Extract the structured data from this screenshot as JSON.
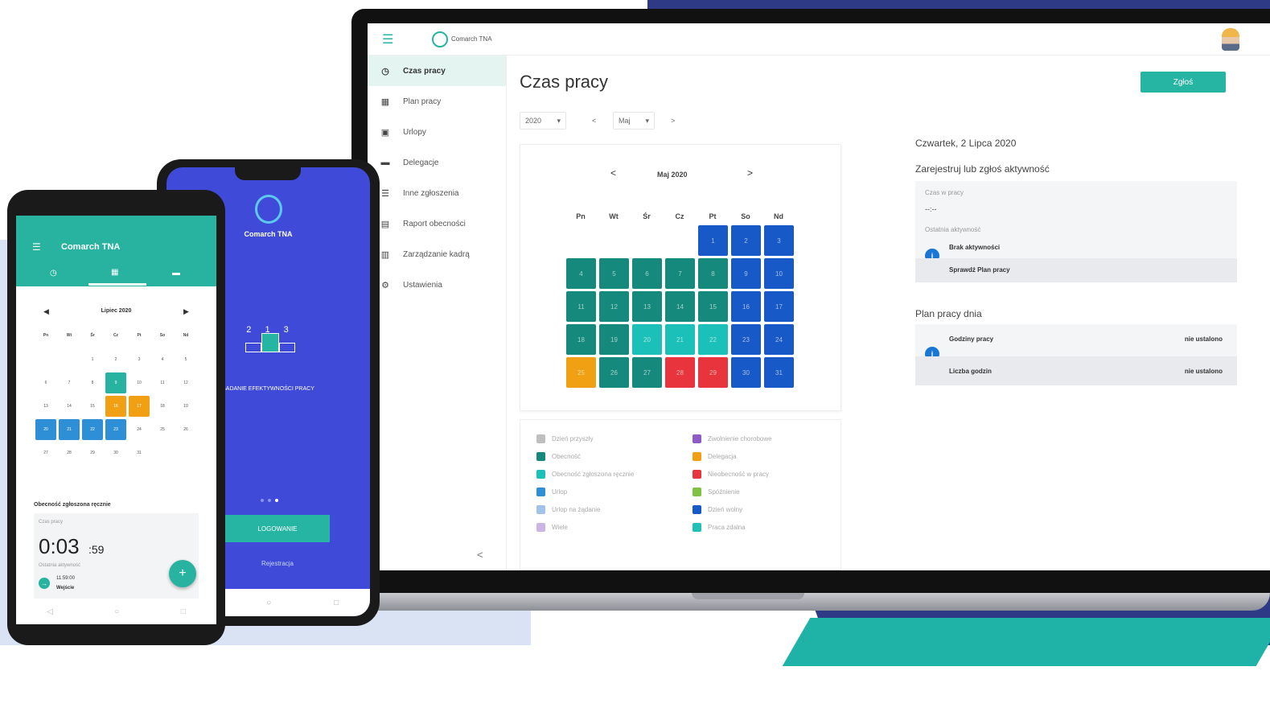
{
  "laptop": {
    "brand": "Comarch TNA",
    "sidebar": [
      {
        "label": "Czas pracy",
        "icon": "clock-icon",
        "active": true
      },
      {
        "label": "Plan pracy",
        "icon": "calendar-icon",
        "active": false
      },
      {
        "label": "Urlopy",
        "icon": "briefcase-icon",
        "active": false
      },
      {
        "label": "Delegacje",
        "icon": "car-icon",
        "active": false
      },
      {
        "label": "Inne zgłoszenia",
        "icon": "list-icon",
        "active": false
      },
      {
        "label": "Raport obecności",
        "icon": "report-icon",
        "active": false
      },
      {
        "label": "Zarządzanie kadrą",
        "icon": "team-icon",
        "active": false
      },
      {
        "label": "Ustawienia",
        "icon": "gear-icon",
        "active": false
      }
    ],
    "collapse_glyph": "<",
    "page_title": "Czas pracy",
    "report_button": "Zgłoś",
    "year_select": "2020",
    "month_select": "Maj",
    "prev_glyph": "<",
    "next_glyph": ">",
    "calendar": {
      "title": "Maj 2020",
      "weekdays": [
        "Pn",
        "Wt",
        "Śr",
        "Cz",
        "Pt",
        "So",
        "Nd"
      ],
      "leading_blanks": 4,
      "days": [
        {
          "n": 1,
          "s": "free"
        },
        {
          "n": 2,
          "s": "free"
        },
        {
          "n": 3,
          "s": "free"
        },
        {
          "n": 4,
          "s": "present"
        },
        {
          "n": 5,
          "s": "present"
        },
        {
          "n": 6,
          "s": "present"
        },
        {
          "n": 7,
          "s": "present"
        },
        {
          "n": 8,
          "s": "present"
        },
        {
          "n": 9,
          "s": "free"
        },
        {
          "n": 10,
          "s": "free"
        },
        {
          "n": 11,
          "s": "present"
        },
        {
          "n": 12,
          "s": "present"
        },
        {
          "n": 13,
          "s": "present"
        },
        {
          "n": 14,
          "s": "present"
        },
        {
          "n": 15,
          "s": "present"
        },
        {
          "n": 16,
          "s": "free"
        },
        {
          "n": 17,
          "s": "free"
        },
        {
          "n": 18,
          "s": "present"
        },
        {
          "n": 19,
          "s": "present"
        },
        {
          "n": 20,
          "s": "manual"
        },
        {
          "n": 21,
          "s": "manual"
        },
        {
          "n": 22,
          "s": "manual"
        },
        {
          "n": 23,
          "s": "free"
        },
        {
          "n": 24,
          "s": "free"
        },
        {
          "n": 25,
          "s": "delegation"
        },
        {
          "n": 26,
          "s": "present"
        },
        {
          "n": 27,
          "s": "present"
        },
        {
          "n": 28,
          "s": "absent"
        },
        {
          "n": 29,
          "s": "absent"
        },
        {
          "n": 30,
          "s": "free"
        },
        {
          "n": 31,
          "s": "free"
        }
      ]
    },
    "status_colors": {
      "present": "#15897c",
      "manual": "#1bc1b8",
      "free": "#1659c7",
      "delegation": "#f0a012",
      "absent": "#e8343c"
    },
    "legend": [
      {
        "label": "Dzień przyszły",
        "color": "#bfbfbf"
      },
      {
        "label": "Obecność",
        "color": "#15897c"
      },
      {
        "label": "Obecność zgłoszona ręcznie",
        "color": "#1bc1b8"
      },
      {
        "label": "Urlop",
        "color": "#2e8fd6"
      },
      {
        "label": "Urlop na żądanie",
        "color": "#9fc3ea"
      },
      {
        "label": "Wiele",
        "color": "#c9b6e4"
      },
      {
        "label": "Zwolnienie chorobowe",
        "color": "#8e5bc7"
      },
      {
        "label": "Delegacja",
        "color": "#f0a012"
      },
      {
        "label": "Nieobecność w pracy",
        "color": "#e8343c"
      },
      {
        "label": "Spóźnienie",
        "color": "#7dc243"
      },
      {
        "label": "Dzień wolny",
        "color": "#1659c7"
      },
      {
        "label": "Praca zdalna",
        "color": "#1fc0b8"
      }
    ],
    "right": {
      "date": "Czwartek, 2 Lipca 2020",
      "register_heading": "Zarejestruj lub zgłoś aktywność",
      "work_time_label": "Czas w pracy",
      "work_time_value": "--:--",
      "last_activity_label": "Ostatnia aktywność",
      "no_activity": "Brak aktywności",
      "check_plan": "Sprawdź Plan pracy",
      "plan_heading": "Plan pracy dnia",
      "hours_label": "Godziny pracy",
      "hours_value": "nie ustalono",
      "count_label": "Liczba godzin",
      "count_value": "nie ustalono"
    }
  },
  "phone_blue": {
    "brand": "Comarch TNA",
    "podium": "2 1 3",
    "caption": "BADANIE EFEKTYWNOŚCI PRACY",
    "login_button": "LOGOWANIE",
    "register_link": "Rejestracja"
  },
  "phone_green": {
    "title": "Comarch TNA",
    "month": "Lipiec 2020",
    "weekdays": [
      "Pn",
      "Wt",
      "Śr",
      "Cz",
      "Pt",
      "So",
      "Nd"
    ],
    "days": [
      1,
      2,
      3,
      4,
      5,
      6,
      7,
      8,
      9,
      10,
      11,
      12,
      13,
      14,
      15,
      16,
      17,
      18,
      19,
      20,
      21,
      22,
      23,
      24,
      25,
      26,
      27,
      28,
      29,
      30,
      31
    ],
    "leading_blanks": 2,
    "highlight": {
      "today": 9,
      "orange": [
        16,
        17
      ],
      "blue": [
        20,
        21,
        22,
        23
      ]
    },
    "section_title": "Obecność zgłoszona ręcznie",
    "work_time_label": "Czas pracy",
    "timer_main": "0:03",
    "timer_sec": ":59",
    "last_activity_label": "Ostatnia aktywność",
    "entry_time": "11:59:00",
    "entry_label": "Wejście",
    "fab_glyph": "+",
    "colors": {
      "teal": "#27b3a0",
      "orange": "#f0a012",
      "blue": "#2e8fd6"
    }
  }
}
